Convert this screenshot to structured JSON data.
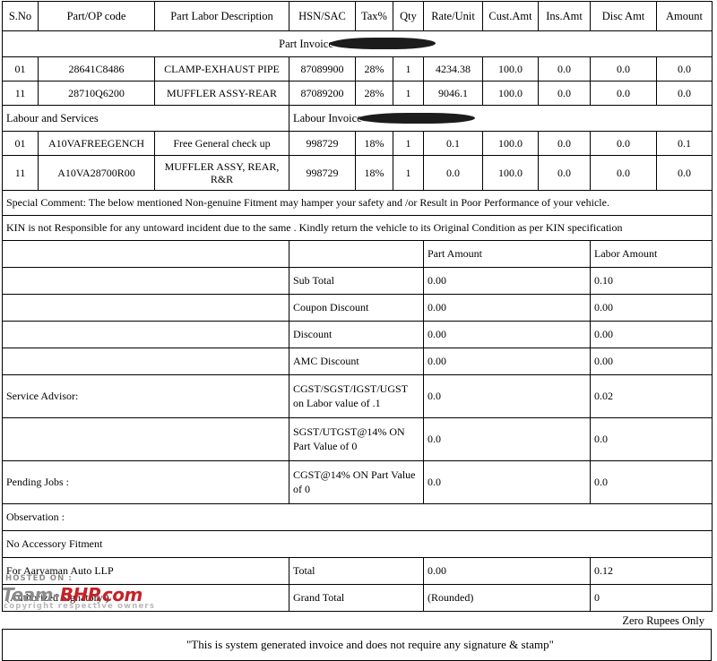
{
  "document": {
    "type": "tax-invoice-service-bill",
    "columns": [
      "S.No",
      "Part/OP code",
      "Part Labor Description",
      "HSN/SAC",
      "Tax%",
      "Qty",
      "Rate/Unit",
      "Cust.Amt",
      "Ins.Amt",
      "Disc Amt",
      "Amount"
    ],
    "part_section": {
      "banner": "Part Invoice",
      "banner_redacted": true,
      "rows": [
        {
          "sno": "01",
          "code": "28641C8486",
          "description": "CLAMP-EXHAUST PIPE",
          "hsn": "87089900",
          "tax": "28%",
          "qty": "1",
          "rate": "4234.38",
          "cust_amt": "100.0",
          "ins_amt": "0.0",
          "disc_amt": "0.0",
          "amount": "0.0"
        },
        {
          "sno": "11",
          "code": "28710Q6200",
          "description": "MUFFLER ASSY-REAR",
          "hsn": "87089200",
          "tax": "28%",
          "qty": "1",
          "rate": "9046.1",
          "cust_amt": "100.0",
          "ins_amt": "0.0",
          "disc_amt": "0.0",
          "amount": "0.0"
        }
      ]
    },
    "labour_section": {
      "title": "Labour and Services",
      "banner": "Labour Invoice",
      "banner_redacted": true,
      "rows": [
        {
          "sno": "01",
          "code": "A10VAFREEGENCH",
          "description": "Free General check up",
          "hsn": "998729",
          "tax": "18%",
          "qty": "1",
          "rate": "0.1",
          "cust_amt": "100.0",
          "ins_amt": "0.0",
          "disc_amt": "0.0",
          "amount": "0.1"
        },
        {
          "sno": "11",
          "code": "A10VA28700R00",
          "description": "MUFFLER ASSY, REAR, R&R",
          "hsn": "998729",
          "tax": "18%",
          "qty": "1",
          "rate": "0.0",
          "cust_amt": "100.0",
          "ins_amt": "0.0",
          "disc_amt": "0.0",
          "amount": "0.0"
        }
      ]
    },
    "notes": [
      "Special Comment: The below mentioned Non-genuine Fitment may hamper your safety and /or Result in Poor Performance of your vehicle.",
      "KIN is not Responsible for any untoward incident due to the same . Kindly return the vehicle to its Original Condition as per KIN specification"
    ],
    "summary": {
      "col_part_amount": "Part Amount",
      "col_labor_amount": "Labor Amount",
      "rows": [
        {
          "left": "",
          "label": "Sub Total",
          "part": "0.00",
          "labor": "0.10"
        },
        {
          "left": "",
          "label": "Coupon Discount",
          "part": "0.00",
          "labor": "0.00"
        },
        {
          "left": "",
          "label": "Discount",
          "part": "0.00",
          "labor": "0.00"
        },
        {
          "left": "",
          "label": "AMC Discount",
          "part": "0.00",
          "labor": "0.00"
        },
        {
          "left": "Service Advisor:",
          "label": "CGST/SGST/IGST/UGST on Labor value of .1",
          "part": "0.0",
          "labor": "0.02"
        },
        {
          "left": "",
          "label": "SGST/UTGST@14% ON Part Value of 0",
          "part": "0.0",
          "labor": "0.0"
        },
        {
          "left": "Pending Jobs :",
          "label": "CGST@14% ON Part Value of 0",
          "part": "0.0",
          "labor": "0.0"
        }
      ],
      "observation": "Observation :",
      "accessory": "No Accessory Fitment",
      "company_for": "For Aaryaman Auto LLP",
      "total_label": "Total",
      "total_part": "0.00",
      "total_labor": "0.12",
      "signatory": "(Authorized Signatory )",
      "grand_total_label": "Grand Total",
      "grand_total_part": "(Rounded)",
      "grand_total_labor": "0",
      "amount_in_words": "Zero Rupees Only"
    },
    "footer_note": "\"This is system generated invoice and does not require any signature & stamp\""
  },
  "watermark": {
    "hosted_on": "HOSTED ON :",
    "logo_team": "Team-",
    "logo_bhp": "BHP.com",
    "copyright": "copyright respective owners",
    "brand_color": "#c62128"
  }
}
